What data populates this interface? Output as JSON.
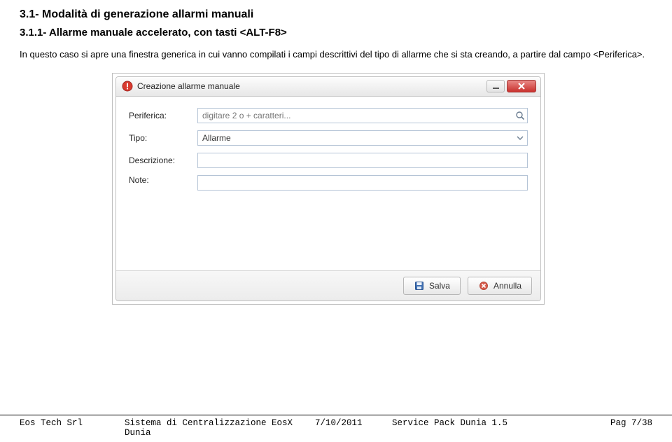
{
  "headings": {
    "h1": "3.1-  Modalità di generazione allarmi manuali",
    "h2": "3.1.1-  Allarme manuale accelerato, con tasti <ALT-F8>"
  },
  "paragraph": "In questo caso si apre una finestra generica in cui vanno compilati i campi descrittivi del tipo di allarme che si sta creando, a partire dal campo <Periferica>.",
  "dialog": {
    "title": "Creazione allarme manuale",
    "fields": {
      "periferica": {
        "label": "Periferica:",
        "placeholder": "digitare 2 o + caratteri..."
      },
      "tipo": {
        "label": "Tipo:",
        "value": "Allarme"
      },
      "descrizione": {
        "label": "Descrizione:",
        "value": ""
      },
      "note": {
        "label": "Note:",
        "value": ""
      }
    },
    "buttons": {
      "save": "Salva",
      "cancel": "Annulla"
    }
  },
  "footer": {
    "company": "Eos Tech Srl",
    "system": "Sistema di Centralizzazione EosX Dunia",
    "date": "7/10/2011",
    "pack": "Service Pack Dunia 1.5",
    "page": "Pag 7/38"
  }
}
